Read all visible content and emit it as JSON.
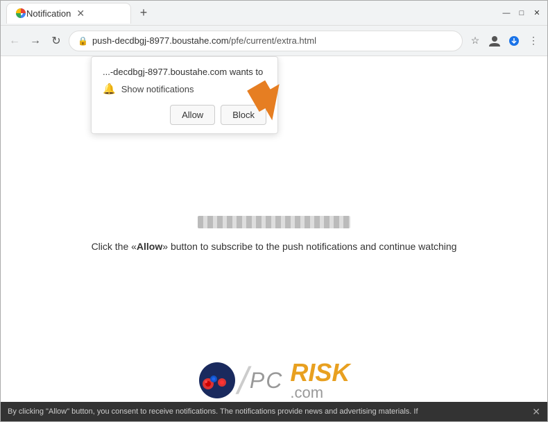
{
  "browser": {
    "tab": {
      "title": "Notification",
      "favicon": "globe"
    },
    "address": {
      "protocol": "https",
      "full_url": "push-decdbgj-8977.boustahe.com/pfe/current/extra.html",
      "domain": "push-decdbgj-8977.boustahe.com",
      "path": "/pfe/current/extra.html"
    },
    "window_controls": {
      "minimize": "—",
      "maximize": "□",
      "close": "✕"
    }
  },
  "notification_popup": {
    "title": "...-decdbgj-8977.boustahe.com wants to",
    "permission_label": "Show notifications",
    "allow_button": "Allow",
    "block_button": "Block"
  },
  "page": {
    "instruction": "Click the «Allow» button to subscribe to the push notifications and continue watching"
  },
  "bottom_bar": {
    "text": "By clicking \"Allow\" button, you consent to receive notifications. The notifications provide news and advertising materials. If"
  },
  "icons": {
    "back": "←",
    "forward": "→",
    "refresh": "↻",
    "lock": "🔒",
    "star": "☆",
    "profile": "👤",
    "menu": "⋮",
    "download": "⬇",
    "bell": "🔔"
  }
}
